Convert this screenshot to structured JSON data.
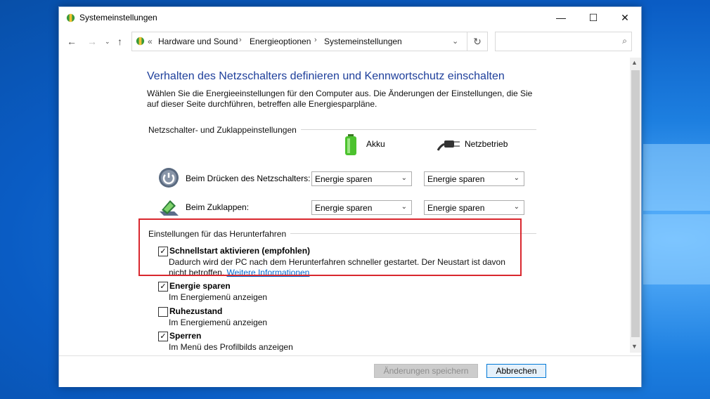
{
  "window": {
    "title": "Systemeinstellungen",
    "controls": {
      "minimize": "—",
      "maximize": "☐",
      "close": "✕"
    }
  },
  "address": {
    "overflow": "«",
    "crumbs": [
      "Hardware und Sound",
      "Energieoptionen",
      "Systemeinstellungen"
    ],
    "search_placeholder": ""
  },
  "page": {
    "heading": "Verhalten des Netzschalters definieren und Kennwortschutz einschalten",
    "description": "Wählen Sie die Energieeinstellungen für den Computer aus. Die Änderungen der Einstellungen, die Sie auf dieser Seite durchführen, betreffen alle Energiesparpläne.",
    "power_group": {
      "title": "Netzschalter- und Zuklappeinstellungen",
      "col_battery": "Akku",
      "col_plugged": "Netzbetrieb",
      "rows": [
        {
          "label": "Beim Drücken des Netzschalters:",
          "battery": "Energie sparen",
          "plugged": "Energie sparen"
        },
        {
          "label": "Beim Zuklappen:",
          "battery": "Energie sparen",
          "plugged": "Energie sparen"
        }
      ]
    },
    "shutdown_group": {
      "title": "Einstellungen für das Herunterfahren",
      "items": [
        {
          "title": "Schnellstart aktivieren (empfohlen)",
          "checked": true,
          "desc": "Dadurch wird der PC nach dem Herunterfahren schneller gestartet. Der Neustart ist davon nicht betroffen.",
          "link": "Weitere Informationen"
        },
        {
          "title": "Energie sparen",
          "checked": true,
          "desc": "Im Energiemenü anzeigen"
        },
        {
          "title": "Ruhezustand",
          "checked": false,
          "desc": "Im Energiemenü anzeigen"
        },
        {
          "title": "Sperren",
          "checked": true,
          "desc": "Im Menü des Profilbilds anzeigen"
        }
      ]
    }
  },
  "footer": {
    "save_label": "Änderungen speichern",
    "cancel_label": "Abbrechen"
  },
  "colors": {
    "heading": "#1e3f9b",
    "link": "#0066cc",
    "highlight": "#d9272e"
  }
}
